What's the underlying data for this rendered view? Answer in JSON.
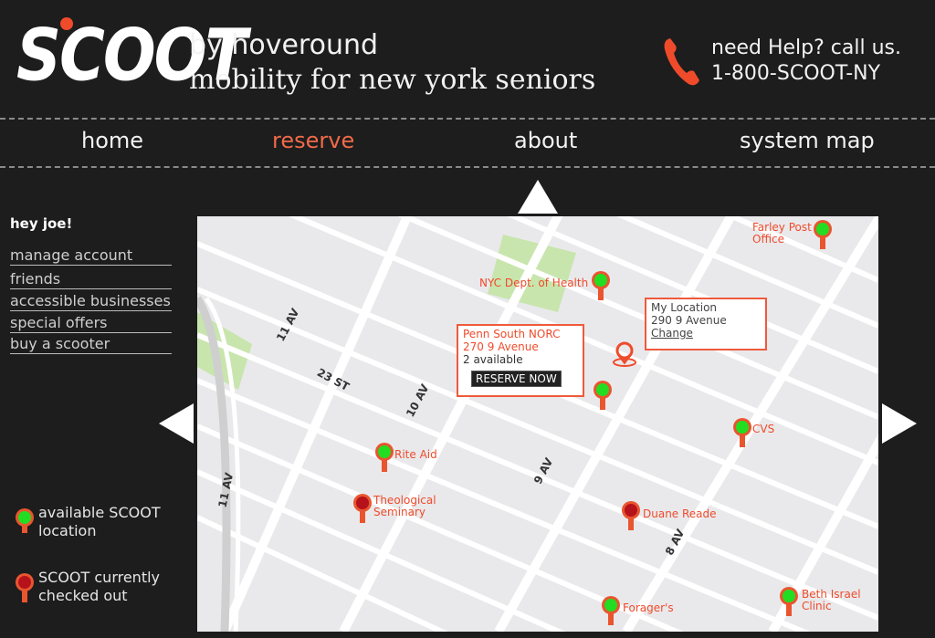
{
  "header": {
    "logo_text": "SCOOT",
    "tagline_1": "by hoveround",
    "tagline_2": "mobility for new york seniors",
    "help_line": "need Help?  call us.",
    "phone_number": "1-800-SCOOT-NY",
    "phone_icon": "phone-handset-icon"
  },
  "nav": {
    "items": [
      {
        "label": "home"
      },
      {
        "label": "reserve"
      },
      {
        "label": "about"
      },
      {
        "label": "system map"
      }
    ],
    "active_index": 1
  },
  "sidebar": {
    "greeting": "hey joe!",
    "links": [
      {
        "label": "manage account"
      },
      {
        "label": "friends"
      },
      {
        "label": "accessible businesses"
      },
      {
        "label": "special offers"
      },
      {
        "label": "buy a scooter"
      }
    ]
  },
  "legend": {
    "available_l1": "available SCOOT",
    "available_l2": "location",
    "checked_out_l1": "SCOOT currently",
    "checked_out_l2": "checked out"
  },
  "map": {
    "streets": [
      "11 AV",
      "23 ST",
      "10 AV",
      "9 AV",
      "11 AV",
      "8 AV"
    ],
    "locations": [
      {
        "name": "Farley Post",
        "name2": "Office",
        "status": "available"
      },
      {
        "name": "NYC Dept. of Health",
        "status": "available"
      },
      {
        "name": "Rite Aid",
        "status": "available"
      },
      {
        "name": "Theological",
        "name2": "Seminary",
        "status": "checked out"
      },
      {
        "name": "CVS",
        "status": "available"
      },
      {
        "name": "Duane Reade",
        "status": "checked out"
      },
      {
        "name": "Forager's",
        "status": "available"
      },
      {
        "name": "Beth Israel",
        "name2": "Clinic",
        "status": "available"
      }
    ],
    "my_location": {
      "title": "My Location",
      "address": "290 9 Avenue",
      "change_label": "Change"
    },
    "selected": {
      "name": "Penn South NORC",
      "address": "270 9 Avenue",
      "availability": "2 available",
      "reserve_label": "RESERVE NOW"
    }
  },
  "colors": {
    "accent": "#ef4b2b",
    "available_pin": "#22dd22",
    "checked_out_pin": "#c0141c",
    "background": "#1d1d1d"
  }
}
